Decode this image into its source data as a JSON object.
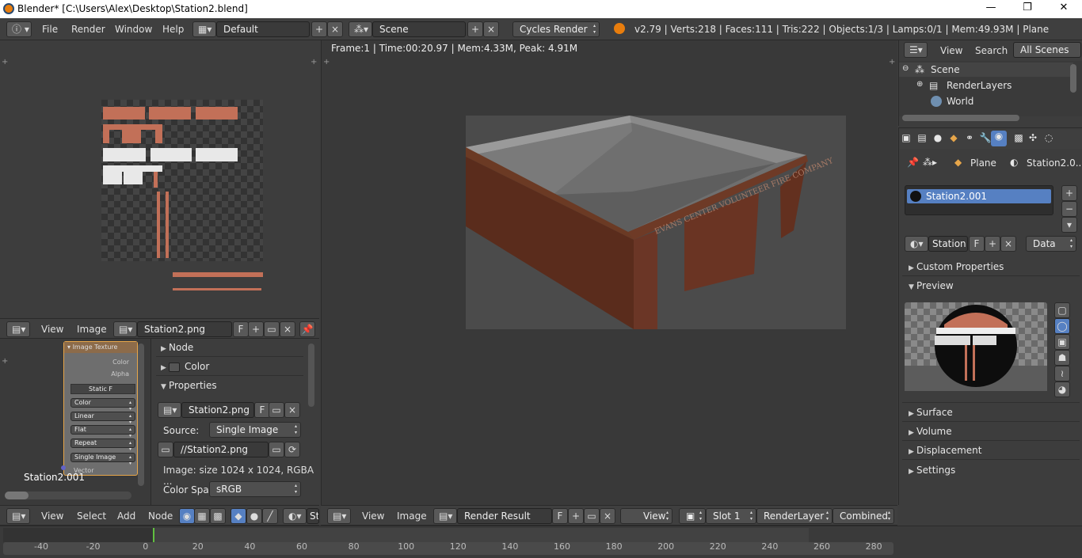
{
  "window": {
    "title": "Blender* [C:\\Users\\Alex\\Desktop\\Station2.blend]",
    "minimize": "—",
    "restore": "❐",
    "close": "✕"
  },
  "topbar": {
    "menus": [
      "File",
      "Render",
      "Window",
      "Help"
    ],
    "layout": "Default",
    "scene": "Scene",
    "engine": "Cycles Render",
    "stats": "v2.79 | Verts:218 | Faces:111 | Tris:222 | Objects:1/3 | Lamps:0/1 | Mem:49.93M | Plane"
  },
  "uv_editor": {
    "header": {
      "view": "View",
      "image": "Image",
      "image_name": "Station2.png",
      "f_label": "F"
    }
  },
  "node_editor": {
    "node_title": "Image Texture",
    "out_color": "Color",
    "out_alpha": "Alpha",
    "node_image_short": "Static",
    "f_label": "F",
    "opts": [
      "Color",
      "Linear",
      "Flat",
      "Repeat",
      "Single Image"
    ],
    "in_vector": "Vector",
    "material_label": "Station2.001",
    "sidebar": {
      "node": "Node",
      "color": "Color",
      "properties": "Properties",
      "image_name": "Station2.png",
      "f_label": "F",
      "source_label": "Source:",
      "source_value": "Single Image",
      "filepath": "//Station2.png",
      "image_info": "Image: size 1024 x 1024, RGBA ...",
      "colorspace_label": "Color Spa",
      "colorspace_value": "sRGB"
    },
    "header": {
      "view": "View",
      "select": "Select",
      "add": "Add",
      "node": "Node",
      "trunc": "St"
    }
  },
  "viewport": {
    "info": "Frame:1 | Time:00:20.97 | Mem:4.33M, Peak: 4.91M",
    "sign_text": "EVANS CENTER VOLUNTEER FIRE COMPANY",
    "header": {
      "view": "View",
      "image": "Image",
      "render_result": "Render Result",
      "f_label": "F",
      "view2": "View",
      "slot": "Slot 1",
      "layer": "RenderLayer",
      "pass": "Combined"
    }
  },
  "outliner": {
    "view": "View",
    "search": "Search",
    "filter": "All Scenes",
    "items": [
      "Scene",
      "RenderLayers",
      "World"
    ]
  },
  "properties": {
    "breadcrumb_object": "Plane",
    "breadcrumb_material": "Station2.0...",
    "material_slot": "Station2.001",
    "mat_field": "Station",
    "f_label": "F",
    "link": "Data",
    "panels": {
      "custom": "Custom Properties",
      "preview": "Preview",
      "surface": "Surface",
      "volume": "Volume",
      "displacement": "Displacement",
      "settings": "Settings"
    }
  },
  "timeline": {
    "ticks": [
      "-40",
      "-20",
      "0",
      "20",
      "40",
      "60",
      "80",
      "100",
      "120",
      "140",
      "160",
      "180",
      "200",
      "220",
      "240",
      "260",
      "280"
    ]
  },
  "colors": {
    "selection": "#5680c2",
    "brick": "#c27058",
    "bg": "#3d3d3d"
  }
}
